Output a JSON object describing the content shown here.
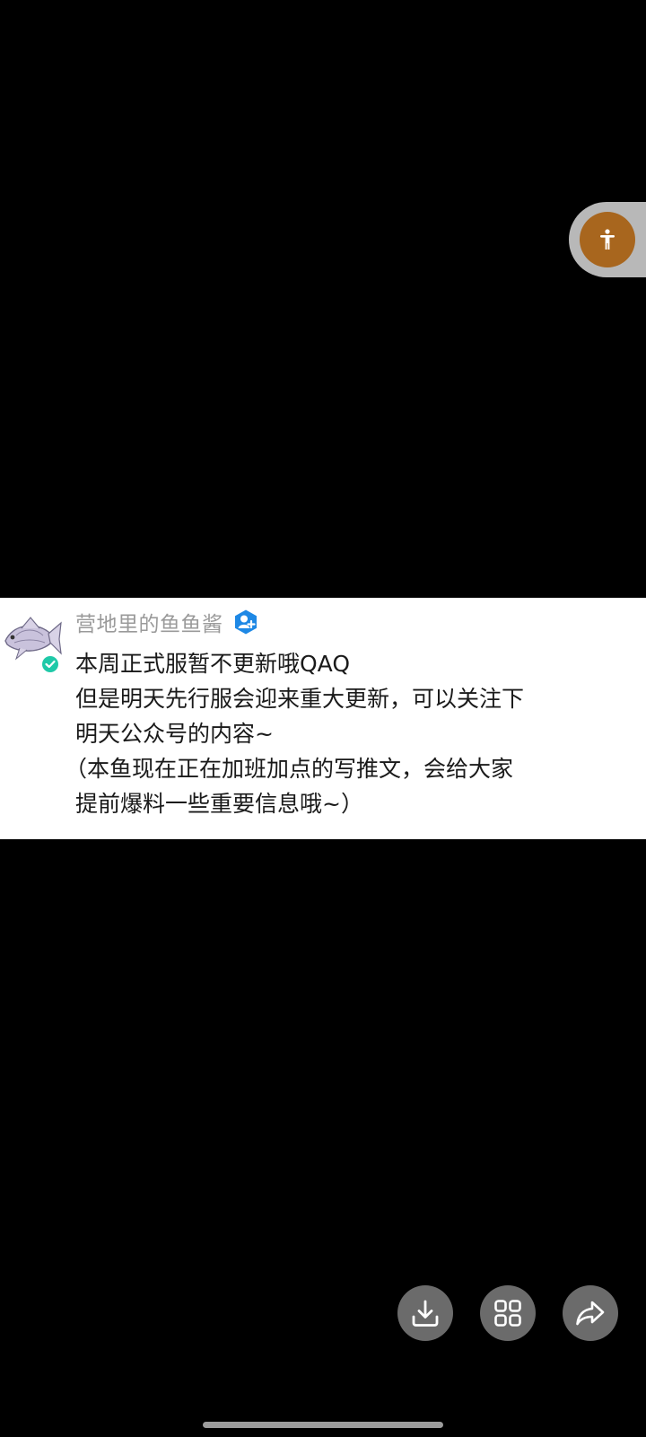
{
  "comment": {
    "username": "营地里的鱼鱼酱",
    "lines": [
      "本周正式服暂不更新哦QAQ",
      "但是明天先行服会迎来重大更新，可以关注下",
      "明天公众号的内容~",
      "（本鱼现在正在加班加点的写推文，会给大家",
      "提前爆料一些重要信息哦~）"
    ]
  },
  "icons": {
    "accessibility": "accessibility-person-icon",
    "download": "download-icon",
    "grid": "grid-icon",
    "share": "share-forward-icon",
    "avatar": "fish-avatar",
    "verified": "verified-check-icon",
    "user_badge": "user-badge-icon"
  },
  "colors": {
    "background": "#000000",
    "card": "#ffffff",
    "accessibility_button": "#a8661e",
    "action_button": "#6b6b6b",
    "username": "#9a9a9a",
    "verified": "#1fc9a8",
    "badge": "#1e88e5"
  }
}
